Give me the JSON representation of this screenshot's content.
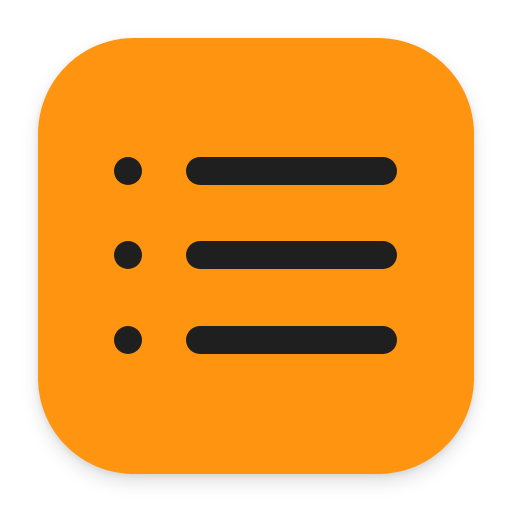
{
  "icon": {
    "name": "list-icon",
    "background_color": "#ff9410",
    "glyph_color": "#1f1f1f",
    "rows": [
      {
        "bullet": "bullet-dot",
        "line": "list-line"
      },
      {
        "bullet": "bullet-dot",
        "line": "list-line"
      },
      {
        "bullet": "bullet-dot",
        "line": "list-line"
      }
    ]
  }
}
